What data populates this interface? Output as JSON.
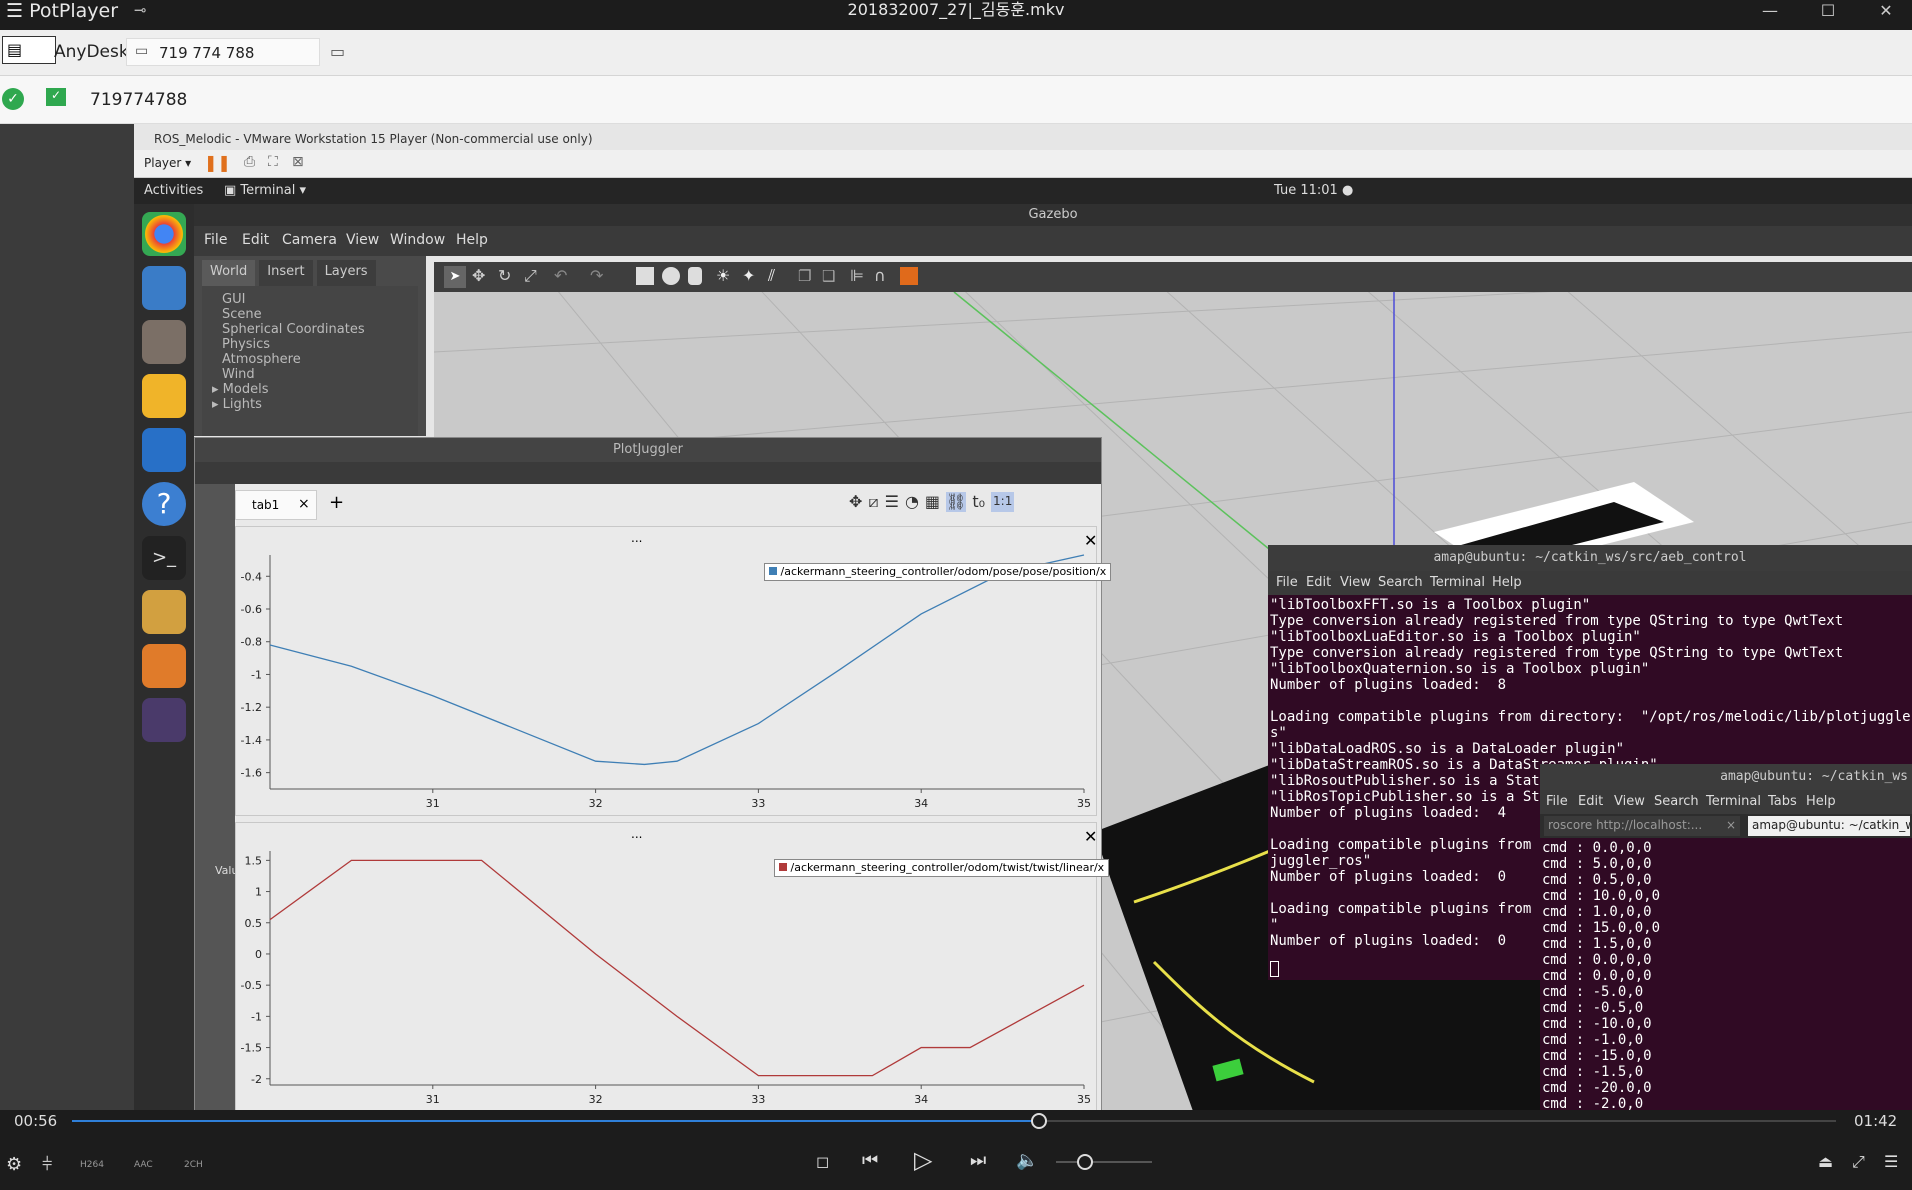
{
  "potplayer": {
    "app_name": "PotPlayer",
    "file_name": "201832007_27|_김동훈.mkv",
    "time_current": "00:56",
    "time_total": "01:42",
    "progress": 0.548,
    "volume": 0.3,
    "codec_labels": [
      "H264",
      "AAC",
      "2CH"
    ]
  },
  "anydesk": {
    "app_label": "AnyDesk",
    "address_tab": "719 774 788",
    "session_id": "719774788"
  },
  "vmware": {
    "title": "ROS_Melodic - VMware Workstation 15 Player (Non-commercial use only)",
    "player_menu": "Player"
  },
  "ubuntu": {
    "activities": "Activities",
    "app_menu": "Terminal",
    "clock": "Tue 11:01"
  },
  "gazebo": {
    "title": "Gazebo",
    "menu": [
      "File",
      "Edit",
      "Camera",
      "View",
      "Window",
      "Help"
    ],
    "tabs": [
      "World",
      "Insert",
      "Layers"
    ],
    "tree": [
      "GUI",
      "Scene",
      "Spherical Coordinates",
      "Physics",
      "Atmosphere",
      "Wind",
      "Models",
      "Lights"
    ]
  },
  "plotjuggler": {
    "title": "PlotJuggler",
    "tab_label": "tab1",
    "side_label": "Values",
    "toolbar_ratio": "1:1",
    "plot_title": "..."
  },
  "chart_data": [
    {
      "type": "line",
      "series": [
        {
          "name": "/ackermann_steering_controller/odom/pose/pose/position/x",
          "color": "#3f7fb5",
          "x": [
            30.0,
            30.5,
            31.0,
            31.5,
            32.0,
            32.3,
            32.5,
            33.0,
            33.5,
            34.0,
            34.5,
            35.0
          ],
          "y": [
            -0.82,
            -0.95,
            -1.13,
            -1.33,
            -1.53,
            -1.55,
            -1.53,
            -1.3,
            -0.97,
            -0.63,
            -0.38,
            -0.27
          ]
        }
      ],
      "xticks": [
        "31",
        "32",
        "33",
        "34",
        "35"
      ],
      "yticks": [
        "-0.4",
        "-0.6",
        "-0.8",
        "-1",
        "-1.2",
        "-1.4",
        "-1.6"
      ],
      "xlim": [
        30.0,
        35.0
      ],
      "ylim": [
        -1.7,
        -0.27
      ]
    },
    {
      "type": "line",
      "series": [
        {
          "name": "/ackermann_steering_controller/odom/twist/twist/linear/x",
          "color": "#b03a3a",
          "x": [
            30.0,
            30.5,
            31.0,
            31.3,
            32.0,
            32.5,
            33.0,
            33.7,
            34.0,
            34.3,
            35.0
          ],
          "y": [
            0.55,
            1.5,
            1.5,
            1.5,
            0.0,
            -1.0,
            -1.95,
            -1.95,
            -1.5,
            -1.5,
            -0.5
          ]
        }
      ],
      "xticks": [
        "31",
        "32",
        "33",
        "34",
        "35"
      ],
      "yticks": [
        "1.5",
        "1",
        "0.5",
        "0",
        "-0.5",
        "-1",
        "-1.5",
        "-2"
      ],
      "xlim": [
        30.0,
        35.0
      ],
      "ylim": [
        -2.1,
        1.65
      ]
    }
  ],
  "terminal1": {
    "title": "amap@ubuntu: ~/catkin_ws/src/aeb_control",
    "menu": [
      "File",
      "Edit",
      "View",
      "Search",
      "Terminal",
      "Help"
    ],
    "lines": [
      "\"libToolboxFFT.so is a Toolbox plugin\"",
      "Type conversion already registered from type QString to type QwtText",
      "\"libToolboxLuaEditor.so is a Toolbox plugin\"",
      "Type conversion already registered from type QString to type QwtText",
      "\"libToolboxQuaternion.so is a Toolbox plugin\"",
      "Number of plugins loaded:  8",
      "",
      "Loading compatible plugins from directory:  \"/opt/ros/melodic/lib/plotjuggler_ro",
      "s\"",
      "\"libDataLoadROS.so is a DataLoader plugin\"",
      "\"libDataStreamROS.so is a DataStreamer plugin\"",
      "\"libRosoutPublisher.so is a StatePublisher plugin\"",
      "\"libRosTopicPublisher.so is a StatePublisher plugin\"",
      "Number of plugins loaded:  4",
      "",
      "Loading compatible plugins from directory:  \"/opt/ros/melodic/lib/plot",
      "juggler_ros\"",
      "Number of plugins loaded:  0",
      "",
      "Loading compatible plugins from directory:",
      "\"",
      "Number of plugins loaded:  0"
    ]
  },
  "terminal2": {
    "title": "amap@ubuntu: ~/catkin_ws",
    "menu": [
      "File",
      "Edit",
      "View",
      "Search",
      "Terminal",
      "Tabs",
      "Help"
    ],
    "tabs": [
      "roscore http://localhost:...",
      "amap@ubuntu: ~/catkin_ws"
    ],
    "lines": [
      "cmd : 0.0,0,0",
      "cmd : 5.0,0,0",
      "cmd : 0.5,0,0",
      "cmd : 10.0,0,0",
      "cmd : 1.0,0,0",
      "cmd : 15.0,0,0",
      "cmd : 1.5,0,0",
      "cmd : 0.0,0,0",
      "cmd : 0.0,0,0",
      "cmd : -5.0,0",
      "cmd : -0.5,0",
      "cmd : -10.0,0",
      "cmd : -1.0,0",
      "cmd : -15.0,0",
      "cmd : -1.5,0",
      "cmd : -20.0,0",
      "cmd : -2.0,0"
    ]
  }
}
